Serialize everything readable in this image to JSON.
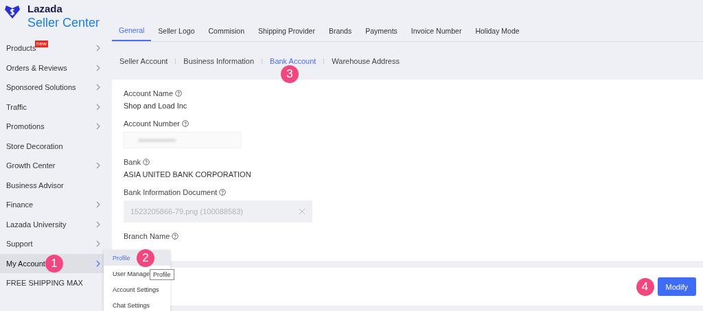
{
  "brand": {
    "name": "Lazada",
    "product": "Seller Center"
  },
  "sidebar": {
    "items": [
      {
        "label": "Products",
        "badge": "new",
        "has_arrow": true,
        "selected": false
      },
      {
        "label": "Orders & Reviews",
        "has_arrow": true,
        "selected": false
      },
      {
        "label": "Sponsored Solutions",
        "has_arrow": true,
        "selected": false
      },
      {
        "label": "Traffic",
        "has_arrow": true,
        "selected": false
      },
      {
        "label": "Promotions",
        "has_arrow": true,
        "selected": false
      },
      {
        "label": "Store Decoration",
        "has_arrow": false,
        "selected": false
      },
      {
        "label": "Growth Center",
        "has_arrow": true,
        "selected": false
      },
      {
        "label": "Business Advisor",
        "has_arrow": false,
        "selected": false
      },
      {
        "label": "Finance",
        "has_arrow": true,
        "selected": false
      },
      {
        "label": "Lazada University",
        "has_arrow": true,
        "selected": false
      },
      {
        "label": "Support",
        "has_arrow": true,
        "selected": false
      },
      {
        "label": "My Account",
        "has_arrow": true,
        "selected": true,
        "marker": "1"
      },
      {
        "label": "FREE SHIPPING MAX",
        "has_arrow": false,
        "selected": false
      }
    ]
  },
  "submenu": {
    "items": [
      {
        "label": "Profile",
        "selected": true,
        "marker": "2"
      },
      {
        "label": "User Manage",
        "selected": false
      },
      {
        "label": "Account Settings",
        "selected": false
      },
      {
        "label": "Chat Settings",
        "selected": false
      }
    ],
    "tooltip": "Profile"
  },
  "tabs": [
    {
      "label": "General",
      "selected": true
    },
    {
      "label": "Seller Logo",
      "selected": false
    },
    {
      "label": "Commision",
      "selected": false
    },
    {
      "label": "Shipping Provider",
      "selected": false
    },
    {
      "label": "Brands",
      "selected": false
    },
    {
      "label": "Payments",
      "selected": false
    },
    {
      "label": "Invoice Number",
      "selected": false
    },
    {
      "label": "Holiday Mode",
      "selected": false
    }
  ],
  "subtabs": [
    {
      "label": "Seller Account",
      "selected": false
    },
    {
      "label": "Business Information",
      "selected": false
    },
    {
      "label": "Bank Account",
      "selected": true,
      "marker": "3"
    },
    {
      "label": "Warehouse Address",
      "selected": false
    }
  ],
  "fields": [
    {
      "kind": "text",
      "label": "Account Name",
      "value": "Shop and Load Inc"
    },
    {
      "kind": "blurred",
      "label": "Account Number"
    },
    {
      "kind": "text",
      "label": "Bank",
      "value": "ASIA UNITED BANK CORPORATION"
    },
    {
      "kind": "file",
      "label": "Bank Information Document",
      "value": "1523205866-79.png (100088583)"
    },
    {
      "kind": "empty",
      "label": "Branch Name"
    }
  ],
  "footer": {
    "button": "Modify",
    "marker": "4"
  }
}
